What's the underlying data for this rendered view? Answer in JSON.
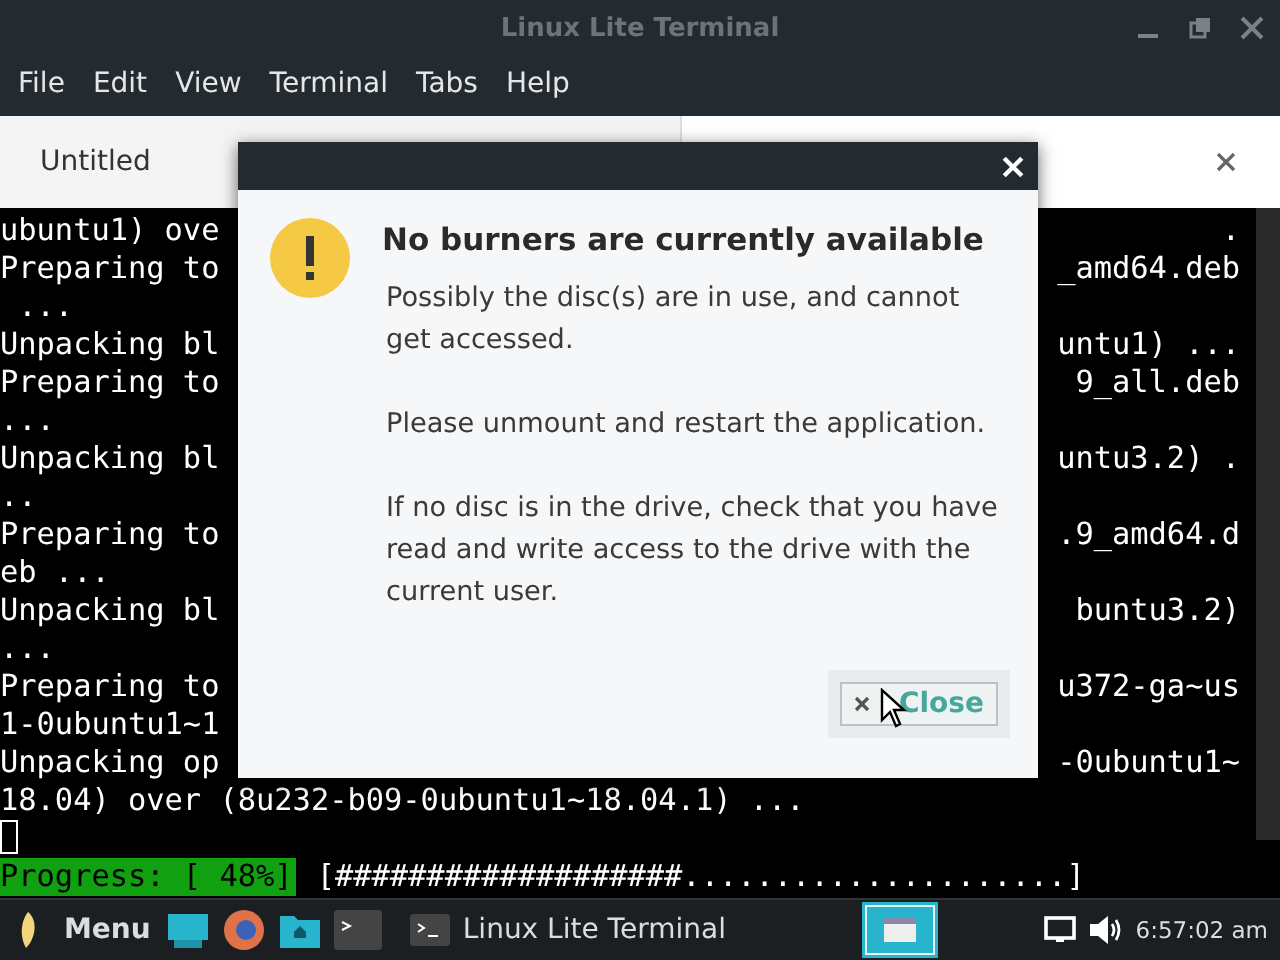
{
  "window": {
    "title": "Linux Lite Terminal"
  },
  "menu": [
    "File",
    "Edit",
    "View",
    "Terminal",
    "Tabs",
    "Help"
  ],
  "tabs": [
    {
      "label": "Untitled"
    }
  ],
  "terminal": {
    "lines": [
      {
        "left": "ubuntu1) ove",
        "right": "."
      },
      {
        "left": "Preparing to",
        "right": "_amd64.deb"
      },
      {
        "left": " ..."
      },
      {
        "left": "Unpacking bl",
        "right": "untu1) ..."
      },
      {
        "left": "Preparing to",
        "right": "9_all.deb"
      },
      {
        "left": "..."
      },
      {
        "left": "Unpacking bl",
        "right": "untu3.2) ."
      },
      {
        "left": ".."
      },
      {
        "left": "Preparing to",
        "right": ".9_amd64.d"
      },
      {
        "left": "eb ..."
      },
      {
        "left": "Unpacking bl",
        "right": "buntu3.2)"
      },
      {
        "left": "..."
      },
      {
        "left": "Preparing to",
        "right": "u372-ga~us"
      },
      {
        "left": "1-0ubuntu1~1"
      },
      {
        "left": "Unpacking op",
        "right": "-0ubuntu1~"
      },
      {
        "left": "18.04) over (8u232-b09-0ubuntu1~18.04.1) ..."
      }
    ],
    "progress_label": "Progress: [ 48%]",
    "progress_bar": "[###################.....................]"
  },
  "dialog": {
    "heading": "No burners are currently available",
    "paragraphs": [
      "Possibly the disc(s) are in use, and cannot get accessed.",
      "Please unmount and restart the application.",
      "If no disc is in the drive, check that you have read and write access to the drive with the current user."
    ],
    "button": "Close"
  },
  "taskbar": {
    "menu": "Menu",
    "task": "Linux Lite Terminal",
    "clock": "6:57:02 am"
  }
}
